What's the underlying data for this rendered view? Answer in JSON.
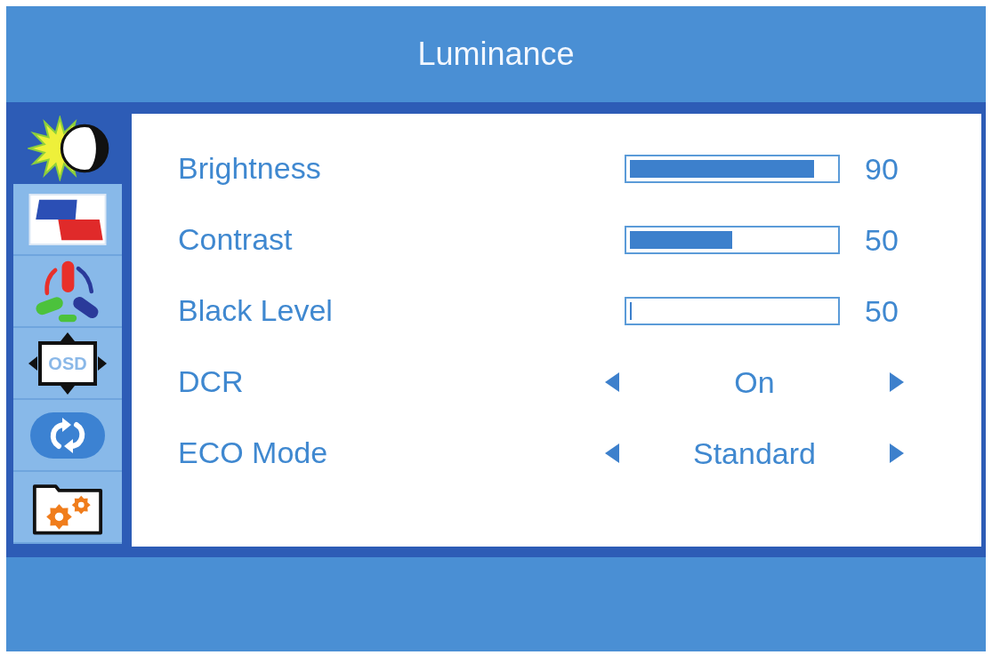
{
  "window": {
    "title": "Luminance"
  },
  "sidebar": {
    "items": [
      {
        "selected": true
      },
      {
        "selected": false
      },
      {
        "selected": false
      },
      {
        "selected": false,
        "icon_text": "OSD"
      },
      {
        "selected": false
      },
      {
        "selected": false
      }
    ]
  },
  "settings": [
    {
      "kind": "slider",
      "label": "Brightness",
      "level": 0.9,
      "reading": "90"
    },
    {
      "kind": "slider",
      "label": "Contrast",
      "level": 0.5,
      "reading": "50"
    },
    {
      "kind": "slider",
      "label": "Black Level",
      "level": 0,
      "reading": "50"
    },
    {
      "kind": "choice",
      "label": "DCR",
      "value": "On"
    },
    {
      "kind": "choice",
      "label": "ECO Mode",
      "value": "Standard"
    }
  ]
}
